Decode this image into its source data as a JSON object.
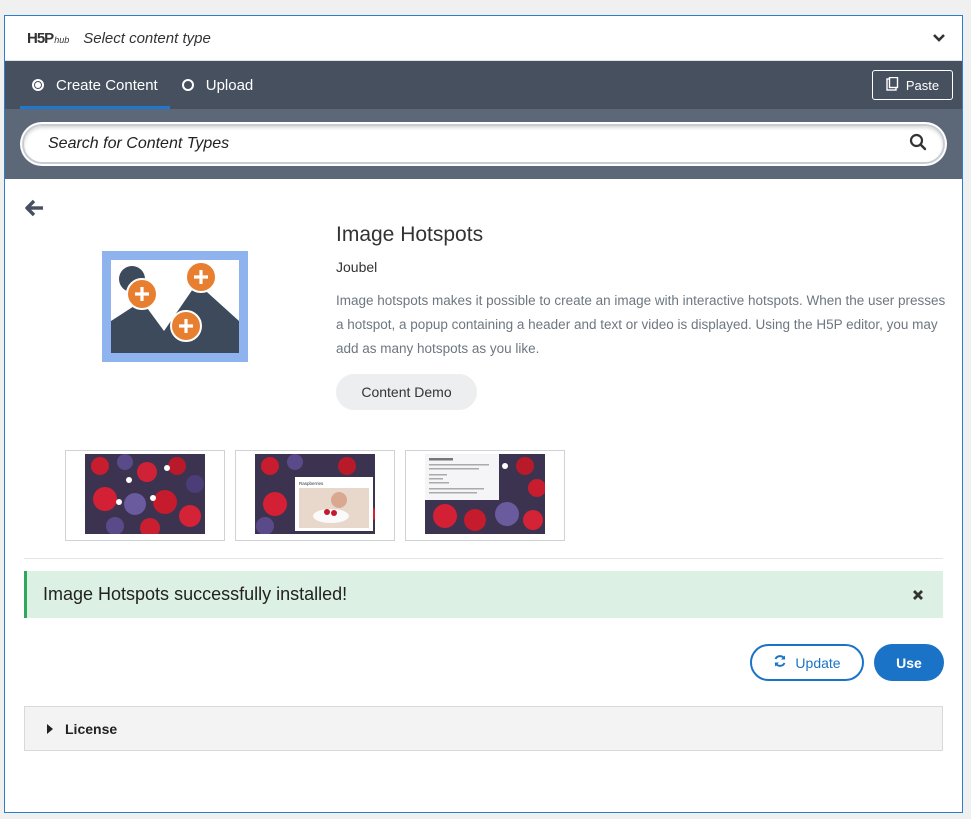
{
  "header": {
    "logo_text": "H5P",
    "logo_suffix": "hub",
    "title": "Select content type"
  },
  "tabs": [
    {
      "label": "Create Content",
      "selected": true
    },
    {
      "label": "Upload",
      "selected": false
    }
  ],
  "paste_label": "Paste",
  "search": {
    "placeholder": "Search for Content Types"
  },
  "detail": {
    "title": "Image Hotspots",
    "owner": "Joubel",
    "description": "Image hotspots makes it possible to create an image with interactive hotspots. When the user presses a hotspot, a popup containing a header and text or video is displayed. Using the H5P editor, you may add as many hotspots as you like.",
    "demo_label": "Content Demo",
    "screenshot_overlay_title": "Raspberries"
  },
  "alert": {
    "message": "Image Hotspots successfully installed!"
  },
  "actions": {
    "update_label": "Update",
    "use_label": "Use"
  },
  "license": {
    "label": "License"
  },
  "colors": {
    "accent": "#1a73c7",
    "tab_bar": "#46505e",
    "search_band": "#5c6777",
    "success_bg": "#dcf0e4",
    "hotspot_orange": "#e87e2f",
    "icon_dark": "#3d4a5c"
  },
  "icons": [
    "chevron-down-icon",
    "radio-icon",
    "paste-icon",
    "search-icon",
    "arrow-left-icon",
    "close-icon",
    "refresh-icon",
    "caret-right-icon"
  ]
}
